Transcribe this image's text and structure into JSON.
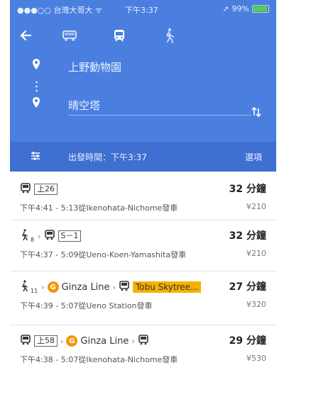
{
  "status_bar": {
    "carrier": "●●●○○ 台灣大哥大 ",
    "time": "下午3:37",
    "battery": "99%"
  },
  "search": {
    "from": "上野動物園",
    "to": "晴空塔"
  },
  "options_bar": {
    "departure": "出發時間：下午3:37",
    "options_label": "選項"
  },
  "routes": [
    {
      "badge1": "上26",
      "duration": "32 分鐘",
      "details": "下午4:41 - 5:13從Ikenohata-Nichome發車",
      "fare": "¥210"
    },
    {
      "walk_sub": "8",
      "badge1": "S－1",
      "duration": "32 分鐘",
      "details": "下午4:37 - 5:09從Ueno-Koen-Yamashita發車",
      "fare": "¥210"
    },
    {
      "walk_sub": "11",
      "line1": "Ginza Line",
      "line2": "Tobu Skytree...",
      "duration": "27 分鐘",
      "details": "下午4:39 - 5:07從Ueno Station發車",
      "fare": "¥320"
    },
    {
      "badge1": "上58",
      "line1": "Ginza Line",
      "duration": "29 分鐘",
      "details": "下午4:38 - 5:07從Ikenohata-Nichome發車",
      "fare": "¥530"
    }
  ],
  "colors": {
    "header": "#4a7fe0",
    "options": "#3f6fd1",
    "ginza": "#f39700",
    "tobu": "#f6b100"
  }
}
